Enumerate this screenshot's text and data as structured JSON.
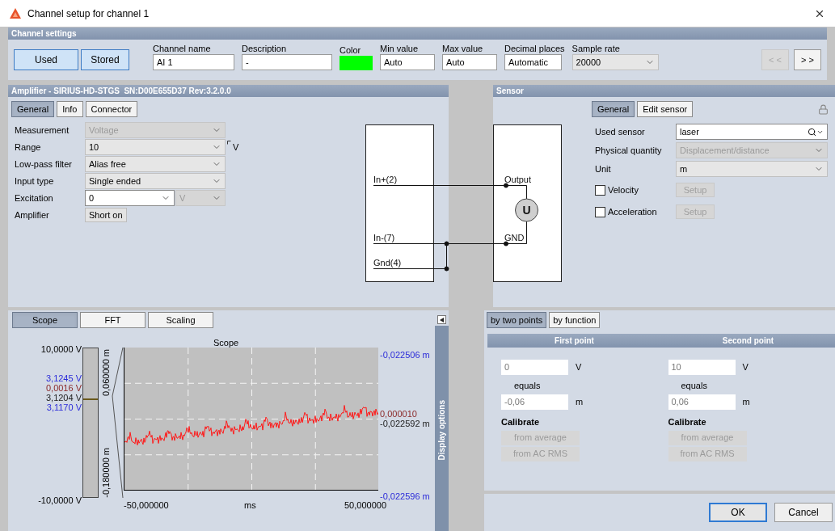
{
  "window": {
    "title": "Channel setup for channel 1"
  },
  "channel_settings": {
    "title": "Channel settings",
    "toggles": [
      {
        "label": "Used",
        "selected": true
      },
      {
        "label": "Stored",
        "selected": true
      }
    ],
    "fields": [
      {
        "label": "Channel name",
        "value": "AI 1",
        "kind": "text"
      },
      {
        "label": "Description",
        "value": "-",
        "kind": "text"
      },
      {
        "label": "Color",
        "kind": "color",
        "color": "#00ff00"
      },
      {
        "label": "Min value",
        "value": "Auto",
        "kind": "text"
      },
      {
        "label": "Max value",
        "value": "Auto",
        "kind": "text"
      },
      {
        "label": "Decimal places",
        "value": "Automatic",
        "kind": "text"
      },
      {
        "label": "Sample rate",
        "value": "20000",
        "kind": "select"
      }
    ],
    "nav_buttons": [
      {
        "label": "< <",
        "disabled": true
      },
      {
        "label": "> >",
        "disabled": false
      }
    ]
  },
  "amplifier": {
    "title": "Amplifier - SIRIUS-HD-STGS  SN:D00E655D37 Rev:3.2.0.0",
    "tabs": [
      {
        "label": "General",
        "selected": true
      },
      {
        "label": "Info",
        "selected": false
      },
      {
        "label": "Connector",
        "selected": false
      }
    ],
    "rows": [
      {
        "label": "Measurement",
        "kind": "select",
        "value": "Voltage",
        "disabled": true
      },
      {
        "label": "Range",
        "kind": "select",
        "value": "10",
        "unit": "V",
        "disabled": false
      },
      {
        "label": "Low-pass filter",
        "kind": "select",
        "value": "Alias free",
        "disabled": false
      },
      {
        "label": "Input type",
        "kind": "select",
        "value": "Single ended",
        "disabled": false
      },
      {
        "label": "Excitation",
        "kind": "select_unit",
        "value": "0",
        "unit": "V",
        "disabled": false
      },
      {
        "label": "Amplifier",
        "kind": "button",
        "value": "Short on",
        "disabled": false
      }
    ]
  },
  "diagram": {
    "amplifier_pins": [
      "In+(2)",
      "In-(7)",
      "Gnd(4)"
    ],
    "sensor_pins": [
      "Output",
      "GND"
    ],
    "source_symbol": "U"
  },
  "sensor": {
    "title": "Sensor",
    "tabs": [
      {
        "label": "General",
        "selected": true
      },
      {
        "label": "Edit sensor",
        "selected": false
      }
    ],
    "rows": [
      {
        "label": "Used sensor",
        "kind": "search",
        "value": "laser",
        "disabled": false
      },
      {
        "label": "Physical quantity",
        "kind": "select",
        "value": "Displacement/distance",
        "disabled": true
      },
      {
        "label": "Unit",
        "kind": "select",
        "value": "m",
        "disabled": false
      }
    ],
    "options": [
      {
        "label": "Velocity",
        "checked": false,
        "button": "Setup",
        "disabled": true
      },
      {
        "label": "Acceleration",
        "checked": false,
        "button": "Setup",
        "disabled": true
      }
    ]
  },
  "scope": {
    "tabs": [
      {
        "label": "Scope",
        "selected": true
      },
      {
        "label": "FFT",
        "selected": false
      },
      {
        "label": "Scaling",
        "selected": false
      }
    ],
    "side_panel": "Display options",
    "title": "Scope",
    "left_top": "10,0000 V",
    "left_bottom": "-10,0000 V",
    "readings": [
      {
        "text": "3,1245 V",
        "color": "#2b2bd9"
      },
      {
        "text": "0,0016 V",
        "color": "#8b2a2a"
      },
      {
        "text": "3,1204 V",
        "color": "#222222"
      },
      {
        "text": "3,1170 V",
        "color": "#2b2bd9"
      }
    ],
    "axis_top": "0,060000 m",
    "axis_bottom": "-0,180000 m",
    "right_top": "-0,022506 m",
    "right_mid": [
      {
        "text": "0,000010",
        "color": "#8b2a2a"
      },
      {
        "text": "-0,022592 m",
        "color": "#222222"
      }
    ],
    "right_bottom": "-0,022596 m",
    "x_labels": [
      "-50,000000",
      "ms",
      "50,000000"
    ]
  },
  "calibration": {
    "tabs": [
      {
        "label": "by two points",
        "selected": true
      },
      {
        "label": "by function",
        "selected": false
      }
    ],
    "points": [
      {
        "title": "First point",
        "input": "0",
        "input_unit": "V",
        "equals": "equals",
        "output": "-0,06",
        "output_unit": "m",
        "calibrate": "Calibrate",
        "buttons": [
          "from average",
          "from AC RMS"
        ]
      },
      {
        "title": "Second point",
        "input": "10",
        "input_unit": "V",
        "equals": "equals",
        "output": "0,06",
        "output_unit": "m",
        "calibrate": "Calibrate",
        "buttons": [
          "from average",
          "from AC RMS"
        ]
      }
    ]
  },
  "footer": {
    "buttons": [
      {
        "label": "OK",
        "default": true
      },
      {
        "label": "Cancel",
        "default": false
      }
    ]
  }
}
